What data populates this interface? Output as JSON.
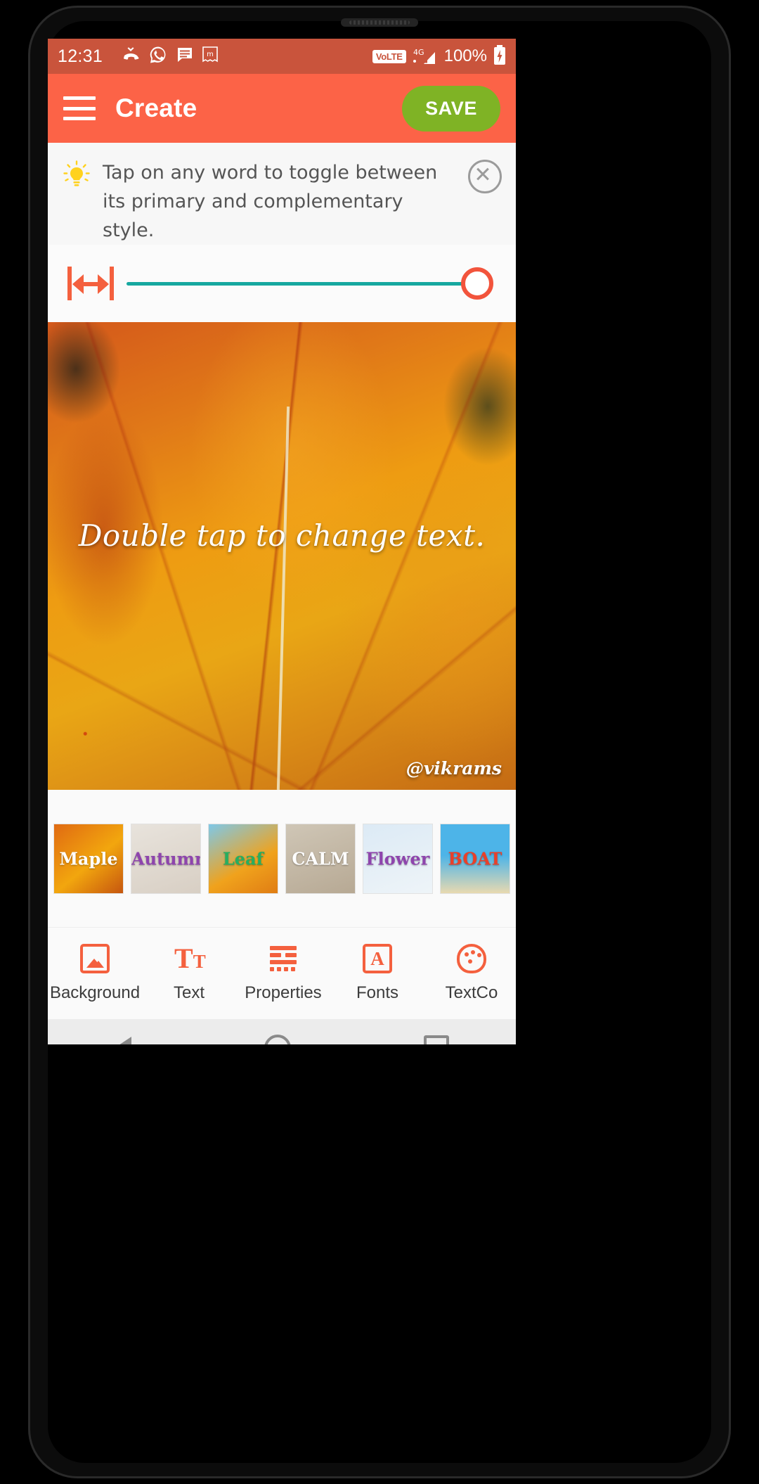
{
  "status_bar": {
    "time": "12:31",
    "icons": [
      "missed-call-icon",
      "whatsapp-icon",
      "message-icon",
      "m-app-icon"
    ],
    "volte": "VoLTE",
    "network": "4G",
    "battery": "100%",
    "bg_color": "#C9543C"
  },
  "app_bar": {
    "menu_icon": "hamburger-menu-icon",
    "title": "Create",
    "save_label": "SAVE",
    "bg_color": "#FC6347",
    "save_color": "#7FB325"
  },
  "hint": {
    "icon": "lightbulb-icon",
    "text": "Tap on any word to toggle between its primary and complementary style.",
    "close_icon": "close-circle-icon"
  },
  "slider": {
    "icon": "text-width-icon",
    "value": 100,
    "track_color": "#17A8A0",
    "thumb_color": "#F2543C"
  },
  "canvas": {
    "text": "Double tap to change text.",
    "watermark": "@vikrams",
    "background": "autumn-maple-leaves-photo"
  },
  "thumbnails": [
    {
      "label": "Maple",
      "label_color": "#ffffff",
      "bg": "linear-gradient(140deg,#e06a12,#f2a60e 55%,#c6560f)"
    },
    {
      "label": "Autumn",
      "label_color": "#8e44ad",
      "bg": "linear-gradient(160deg,#e8e3dc,#d8cfc4)"
    },
    {
      "label": "Leaf",
      "label_color": "#27ae60",
      "bg": "linear-gradient(150deg,#7ec8e8,#f0a21c 60%,#e07d14)"
    },
    {
      "label": "CALM",
      "label_color": "#ffffff",
      "bg": "linear-gradient(160deg,#cfc6b6,#b7a994)"
    },
    {
      "label": "Flower",
      "label_color": "#8e44ad",
      "bg": "linear-gradient(160deg,#dceaf5,#eef4f8)"
    },
    {
      "label": "BOAT",
      "label_color": "#e8402a",
      "bg": "linear-gradient(180deg,#4db4e8 45%,#e8d9b0)"
    }
  ],
  "toolbar": [
    {
      "label": "Background",
      "icon": "image-icon"
    },
    {
      "label": "Text",
      "icon": "text-size-icon"
    },
    {
      "label": "Properties",
      "icon": "properties-lines-icon"
    },
    {
      "label": "Fonts",
      "icon": "font-a-icon"
    },
    {
      "label": "TextCo",
      "icon": "palette-icon"
    }
  ],
  "nav_bar": {
    "back": "back-triangle-icon",
    "home": "home-circle-icon",
    "recents": "recents-square-icon"
  }
}
